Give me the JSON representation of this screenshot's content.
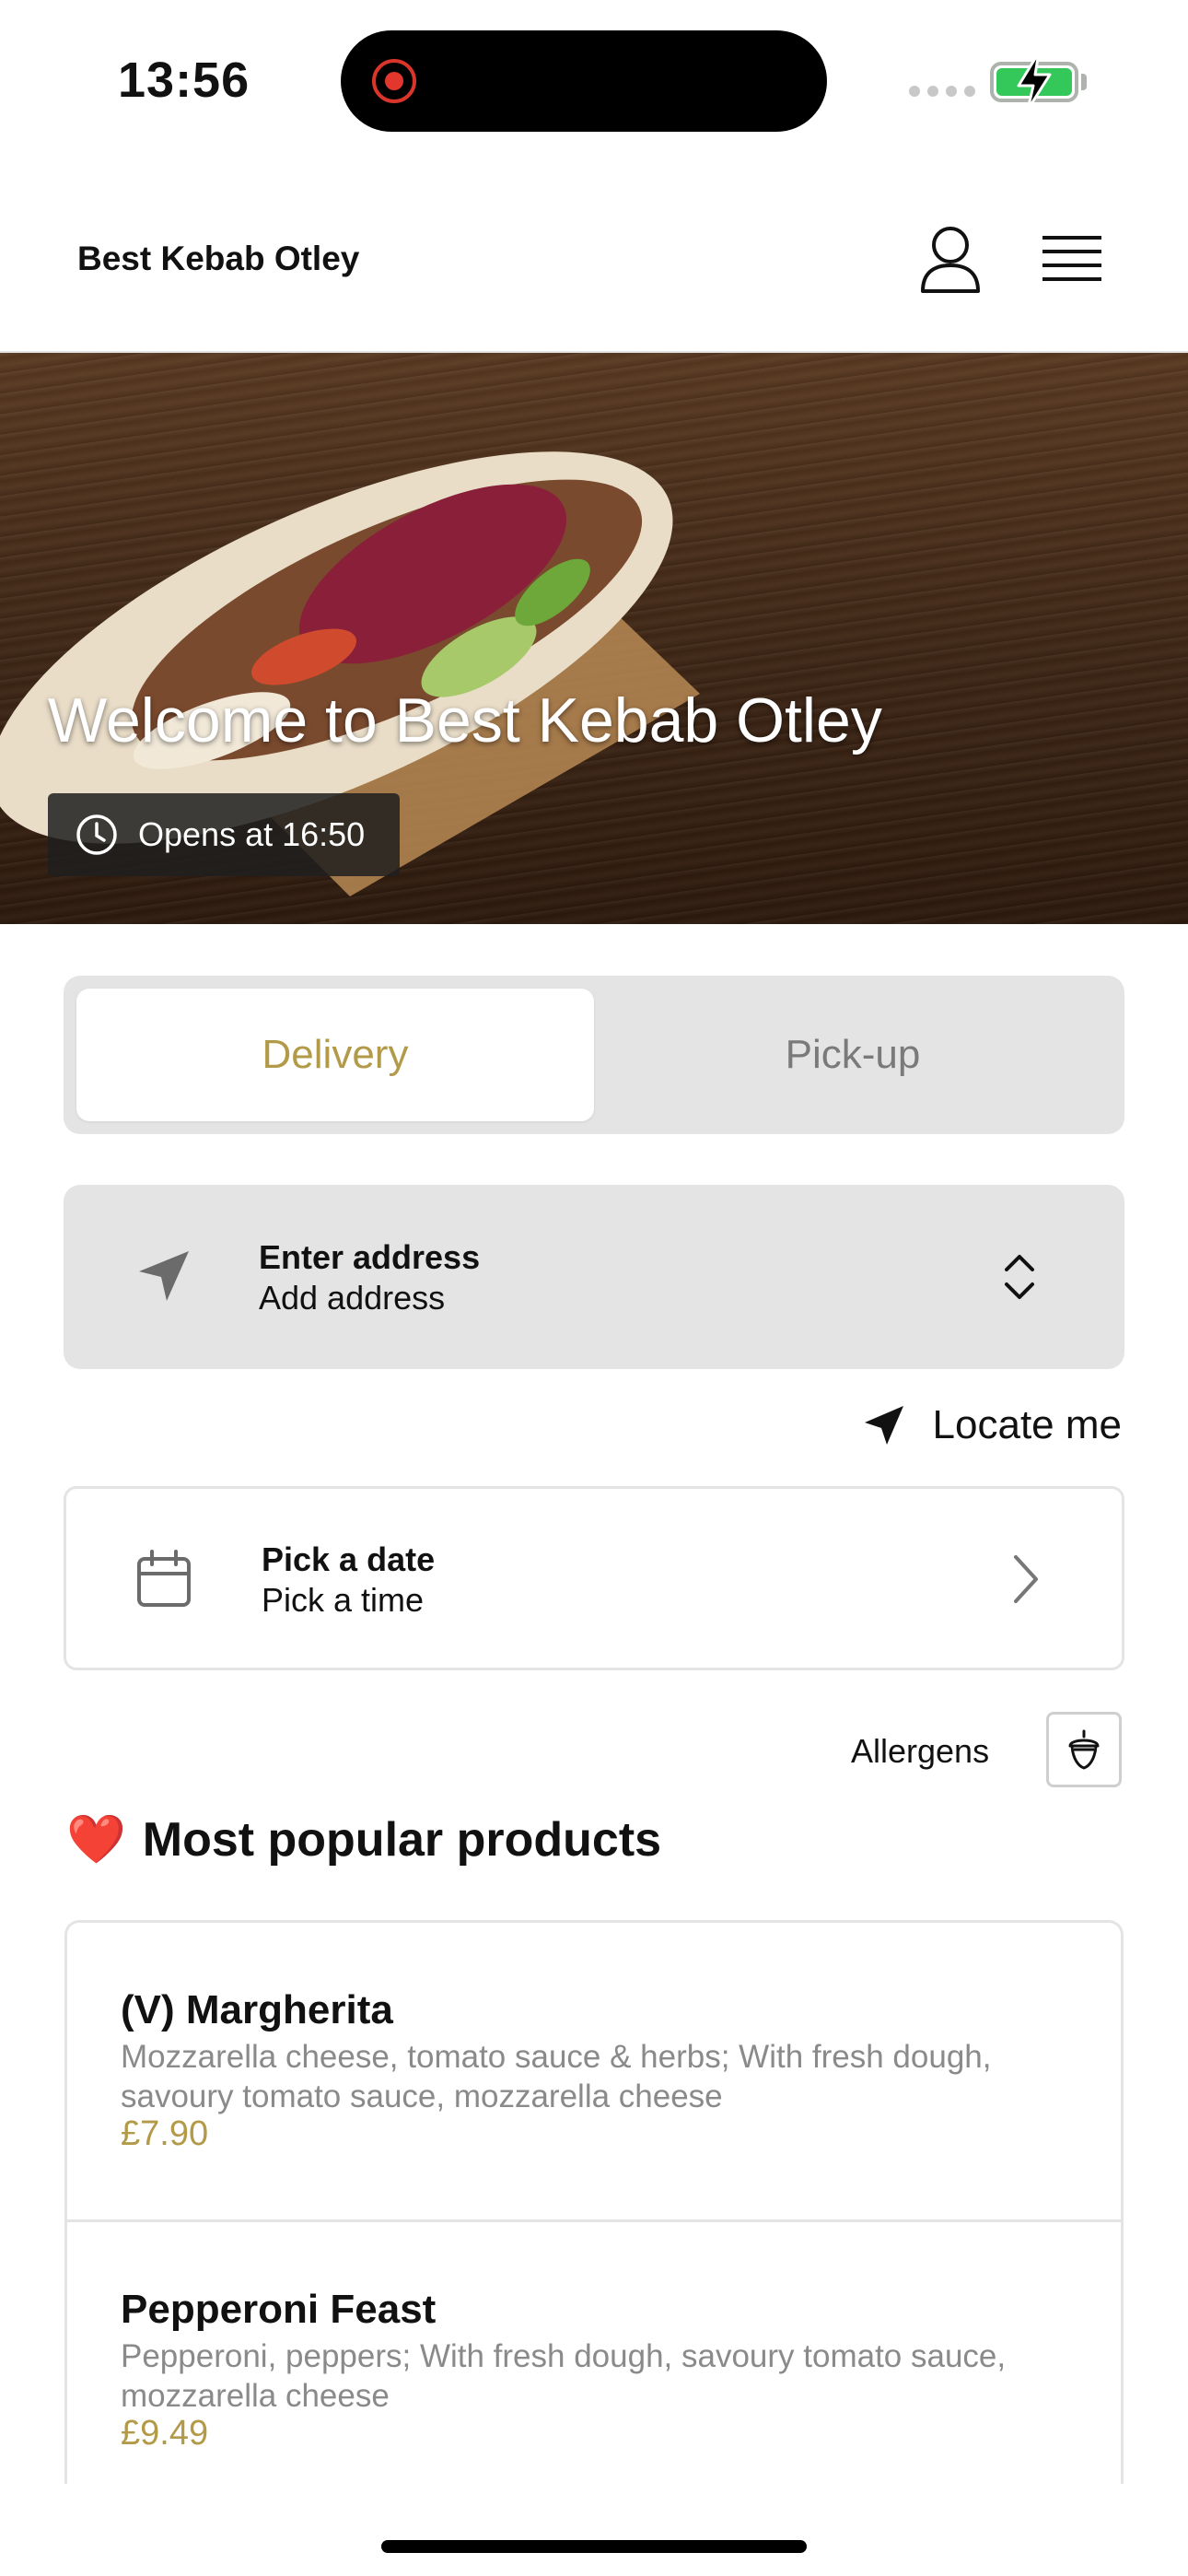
{
  "status_bar": {
    "time": "13:56"
  },
  "header": {
    "brand": "Best Kebab Otley"
  },
  "hero": {
    "title": "Welcome to Best Kebab Otley",
    "hours": "Opens at 16:50"
  },
  "mode": {
    "delivery": "Delivery",
    "pickup": "Pick-up",
    "selected": "Delivery"
  },
  "address": {
    "title": "Enter address",
    "subtitle": "Add address"
  },
  "locate": {
    "label": "Locate me"
  },
  "schedule": {
    "title": "Pick a date",
    "subtitle": "Pick a time"
  },
  "allergens": {
    "label": "Allergens"
  },
  "popular": {
    "emoji": "❤️",
    "title": "Most popular products",
    "items": [
      {
        "name": "(V) Margherita",
        "description": "Mozzarella cheese, tomato sauce & herbs; With fresh dough, savoury tomato sauce, mozzarella cheese",
        "price": "£7.90"
      },
      {
        "name": "Pepperoni Feast",
        "description": "Pepperoni, peppers; With fresh dough, savoury tomato sauce, mozzarella cheese",
        "price": "£9.49"
      }
    ]
  },
  "colors": {
    "accent": "#b29a48",
    "panel": "#e4e4e4",
    "battery": "#34c759",
    "record": "#e3362c"
  },
  "icons": [
    "user-icon",
    "menu-icon",
    "clock-icon",
    "navigation-arrow-icon",
    "chevron-up-down-icon",
    "locate-arrow-icon",
    "calendar-icon",
    "chevron-right-icon",
    "acorn-icon",
    "heart-icon"
  ]
}
